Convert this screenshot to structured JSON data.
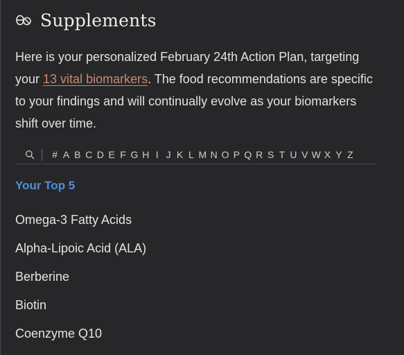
{
  "header": {
    "icon": "pills-icon",
    "title": "Supplements"
  },
  "intro": {
    "text_before": "Here is your personalized February 24th Action Plan, targeting your ",
    "link_text": "13 vital biomarkers",
    "text_after": ". The food recommendations are specific to your findings and will continually evolve as your biomarkers shift over time."
  },
  "alphabet_nav": {
    "search_icon": "search-icon",
    "letters": [
      "#",
      "A",
      "B",
      "C",
      "D",
      "E",
      "F",
      "G",
      "H",
      "I",
      "J",
      "K",
      "L",
      "M",
      "N",
      "O",
      "P",
      "Q",
      "R",
      "S",
      "T",
      "U",
      "V",
      "W",
      "X",
      "Y",
      "Z"
    ]
  },
  "top_section": {
    "title": "Your Top 5",
    "items": [
      "Omega-3 Fatty Acids",
      "Alpha-Lipoic Acid (ALA)",
      "Berberine",
      "Biotin",
      "Coenzyme Q10"
    ]
  },
  "colors": {
    "background": "#27272a",
    "link": "#c98a6e",
    "accent_blue": "#4d8fe0",
    "text": "#e4e4e4"
  }
}
